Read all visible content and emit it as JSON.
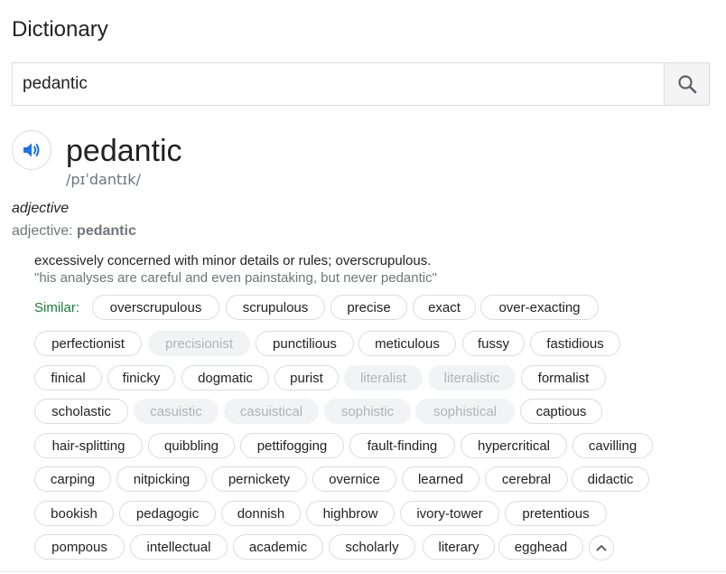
{
  "header": {
    "title": "Dictionary"
  },
  "search": {
    "value": "pedantic",
    "button_icon": "search-icon"
  },
  "entry": {
    "audio_icon": "speaker-icon",
    "word": "pedantic",
    "phonetic": "/pɪˈdantɪk/",
    "part_of_speech": "adjective",
    "form_label": "adjective: ",
    "form_word": "pedantic",
    "definition": "excessively concerned with minor details or rules; overscrupulous.",
    "example": "\"his analyses are careful and even painstaking, but never pedantic\""
  },
  "similar": {
    "label": "Similar:",
    "chips": [
      {
        "text": "overscrupulous",
        "dim": false
      },
      {
        "text": "scrupulous",
        "dim": false
      },
      {
        "text": "precise",
        "dim": false
      },
      {
        "text": "exact",
        "dim": false
      },
      {
        "text": "over-exacting",
        "dim": false
      },
      {
        "text": "perfectionist",
        "dim": false
      },
      {
        "text": "precisionist",
        "dim": true
      },
      {
        "text": "punctilious",
        "dim": false
      },
      {
        "text": "meticulous",
        "dim": false
      },
      {
        "text": "fussy",
        "dim": false
      },
      {
        "text": "fastidious",
        "dim": false
      },
      {
        "text": "finical",
        "dim": false
      },
      {
        "text": "finicky",
        "dim": false
      },
      {
        "text": "dogmatic",
        "dim": false
      },
      {
        "text": "purist",
        "dim": false
      },
      {
        "text": "literalist",
        "dim": true
      },
      {
        "text": "literalistic",
        "dim": true
      },
      {
        "text": "formalist",
        "dim": false
      },
      {
        "text": "scholastic",
        "dim": false
      },
      {
        "text": "casuistic",
        "dim": true
      },
      {
        "text": "casuistical",
        "dim": true
      },
      {
        "text": "sophistic",
        "dim": true
      },
      {
        "text": "sophistical",
        "dim": true
      },
      {
        "text": "captious",
        "dim": false
      },
      {
        "text": "hair-splitting",
        "dim": false
      },
      {
        "text": "quibbling",
        "dim": false
      },
      {
        "text": "pettifogging",
        "dim": false
      },
      {
        "text": "fault-finding",
        "dim": false
      },
      {
        "text": "hypercritical",
        "dim": false
      },
      {
        "text": "cavilling",
        "dim": false
      },
      {
        "text": "carping",
        "dim": false
      },
      {
        "text": "nitpicking",
        "dim": false
      },
      {
        "text": "pernickety",
        "dim": false
      },
      {
        "text": "overnice",
        "dim": false
      },
      {
        "text": "learned",
        "dim": false
      },
      {
        "text": "cerebral",
        "dim": false
      },
      {
        "text": "didactic",
        "dim": false
      },
      {
        "text": "bookish",
        "dim": false
      },
      {
        "text": "pedagogic",
        "dim": false
      },
      {
        "text": "donnish",
        "dim": false
      },
      {
        "text": "highbrow",
        "dim": false
      },
      {
        "text": "ivory-tower",
        "dim": false
      },
      {
        "text": "pretentious",
        "dim": false
      },
      {
        "text": "pompous",
        "dim": false
      },
      {
        "text": "intellectual",
        "dim": false
      },
      {
        "text": "academic",
        "dim": false
      },
      {
        "text": "scholarly",
        "dim": false
      },
      {
        "text": "literary",
        "dim": false
      },
      {
        "text": "egghead",
        "dim": false
      }
    ],
    "collapse_icon": "chevron-up-icon"
  },
  "colors": {
    "similar_label": "#188038",
    "speaker_blue": "#1a73e8",
    "dim_chip_bg": "#f1f3f4",
    "dim_chip_text": "#b0b3b8"
  }
}
